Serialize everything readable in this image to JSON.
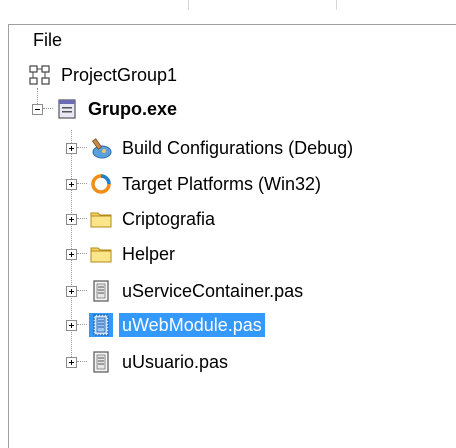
{
  "menu": {
    "file_label": "File"
  },
  "tree": {
    "root": {
      "label": "ProjectGroup1",
      "icon": "project-group-icon"
    },
    "project": {
      "label": "Grupo.exe",
      "icon": "exe-project-icon",
      "expanded": true
    },
    "children": [
      {
        "label": "Build Configurations (Debug)",
        "icon": "build-config-icon",
        "selected": false
      },
      {
        "label": "Target Platforms (Win32)",
        "icon": "target-platform-icon",
        "selected": false
      },
      {
        "label": "Criptografia",
        "icon": "folder-icon",
        "selected": false
      },
      {
        "label": "Helper",
        "icon": "folder-icon",
        "selected": false
      },
      {
        "label": "uServiceContainer.pas",
        "icon": "pas-file-icon",
        "selected": false
      },
      {
        "label": "uWebModule.pas",
        "icon": "pas-file-icon",
        "selected": true
      },
      {
        "label": "uUsuario.pas",
        "icon": "pas-file-icon",
        "selected": false
      }
    ]
  },
  "colors": {
    "selection": "#3399ff",
    "folder": "#f3d35d",
    "platform_ring": "#f28c1b"
  }
}
